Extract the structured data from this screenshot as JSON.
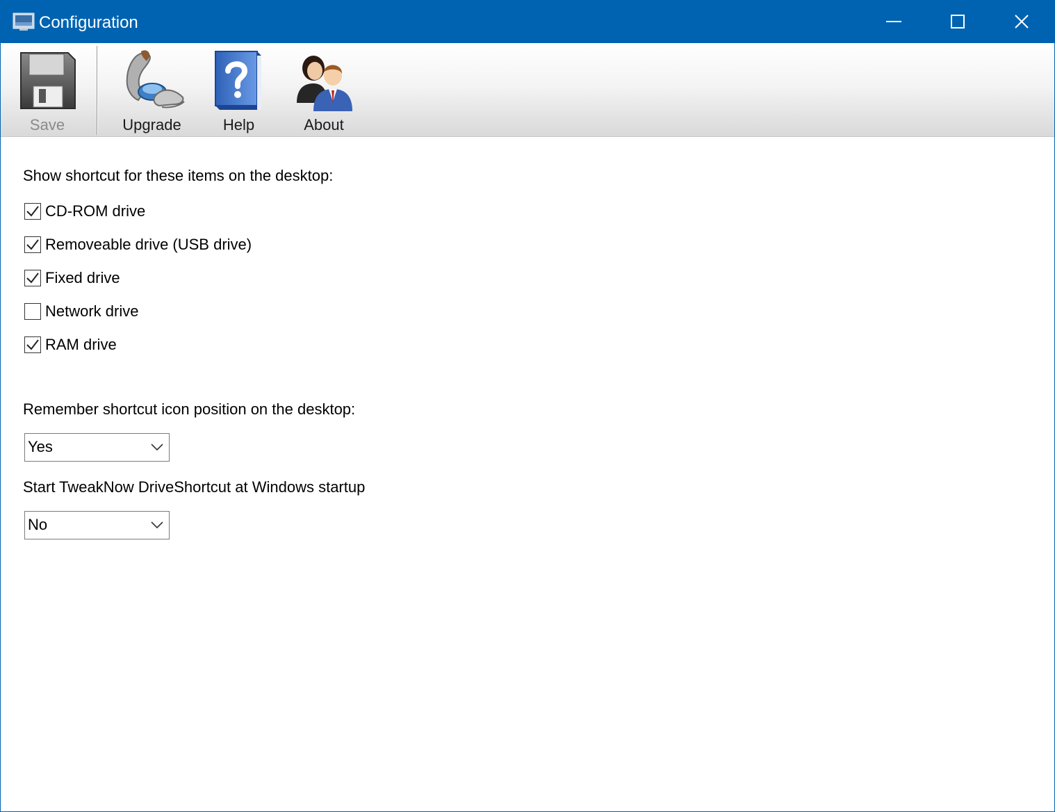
{
  "window": {
    "title": "Configuration",
    "controls": {
      "minimize_icon": "minimize-icon",
      "maximize_icon": "maximize-icon",
      "close_icon": "close-icon"
    }
  },
  "toolbar": {
    "buttons": [
      {
        "label": "Save",
        "icon": "floppy-disk-icon",
        "enabled": false
      },
      {
        "label": "Upgrade",
        "icon": "upgrade-hands-icon",
        "enabled": true
      },
      {
        "label": "Help",
        "icon": "help-book-icon",
        "enabled": true
      },
      {
        "label": "About",
        "icon": "people-icon",
        "enabled": true
      }
    ]
  },
  "shortcuts": {
    "heading": "Show shortcut for these items on the desktop:",
    "items": [
      {
        "label": "CD-ROM drive",
        "checked": true
      },
      {
        "label": "Removeable drive (USB drive)",
        "checked": true
      },
      {
        "label": "Fixed drive",
        "checked": true
      },
      {
        "label": "Network drive",
        "checked": false
      },
      {
        "label": "RAM drive",
        "checked": true
      }
    ]
  },
  "remember_position": {
    "label": "Remember shortcut icon position on the desktop:",
    "selected": "Yes"
  },
  "startup": {
    "label": "Start TweakNow DriveShortcut at Windows startup",
    "selected": "No"
  },
  "colors": {
    "titlebar": "#0063b1",
    "window_bg": "#ffffff"
  }
}
